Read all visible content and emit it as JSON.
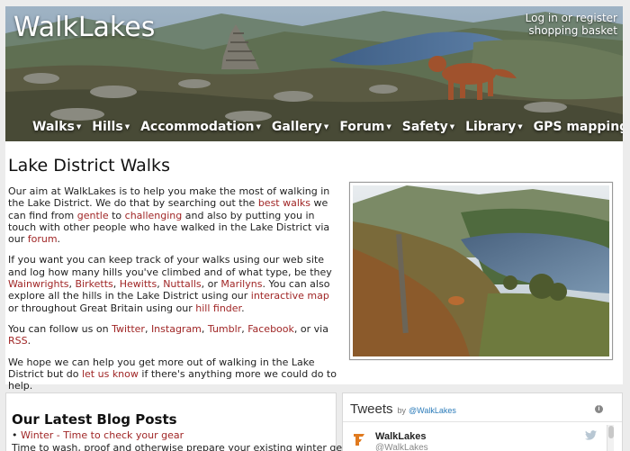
{
  "site": {
    "title": "WalkLakes"
  },
  "account": {
    "login_label": "Log in or register",
    "basket_label": "shopping basket"
  },
  "nav": [
    {
      "label": "Walks",
      "dropdown": true
    },
    {
      "label": "Hills",
      "dropdown": true
    },
    {
      "label": "Accommodation",
      "dropdown": true
    },
    {
      "label": "Gallery",
      "dropdown": true
    },
    {
      "label": "Forum",
      "dropdown": true
    },
    {
      "label": "Safety",
      "dropdown": true
    },
    {
      "label": "Library",
      "dropdown": true
    },
    {
      "label": "GPS mapping",
      "dropdown": false
    }
  ],
  "main": {
    "title": "Lake District Walks",
    "p1": {
      "t1": "Our aim at WalkLakes is to help you make the most of walking in the Lake District. We do that by searching out the ",
      "l1": "best walks",
      "t2": " we can find from ",
      "l2": "gentle",
      "t3": " to ",
      "l3": "challenging",
      "t4": " and also by putting you in touch with other people who have walked in the Lake District via our ",
      "l4": "forum",
      "t5": "."
    },
    "p2": {
      "t1": "If you want you can keep track of your walks using our web site and log how many hills you've climbed and of what type, be they ",
      "l1": "Wainwrights",
      "t2": ", ",
      "l2": "Birketts",
      "t3": ", ",
      "l3": "Hewitts",
      "t4": ", ",
      "l4": "Nuttalls",
      "t5": ", or ",
      "l5": "Marilyns",
      "t6": ". You can also explore all the hills in the Lake District using our ",
      "l6": "interactive map",
      "t7": " or throughout Great Britain using our ",
      "l7": "hill finder",
      "t8": "."
    },
    "p3": {
      "t1": "You can follow us on ",
      "l1": "Twitter",
      "t2": ", ",
      "l2": "Instagram",
      "t3": ", ",
      "l3": "Tumblr",
      "t4": ", ",
      "l4": "Facebook",
      "t5": ", or via ",
      "l5": "RSS",
      "t6": "."
    },
    "p4": {
      "t1": "We hope we can help you get more out of walking in the Lake District but do ",
      "l1": "let us know",
      "t2": " if there's anything more we could do to help."
    }
  },
  "blog": {
    "title": "Our Latest Blog Posts",
    "bullet": "•",
    "item_link": "Winter - Time to check your gear",
    "snippet": "Time to wash, proof and otherwise prepare your existing winter gear; and"
  },
  "tweets": {
    "title": "Tweets",
    "by": "by",
    "handle": "@WalkLakes",
    "info": "i",
    "account_name": "WalkLakes",
    "account_handle": "@WalkLakes"
  },
  "colors": {
    "link": "#a02626",
    "twitter": "#2b7bb9"
  }
}
